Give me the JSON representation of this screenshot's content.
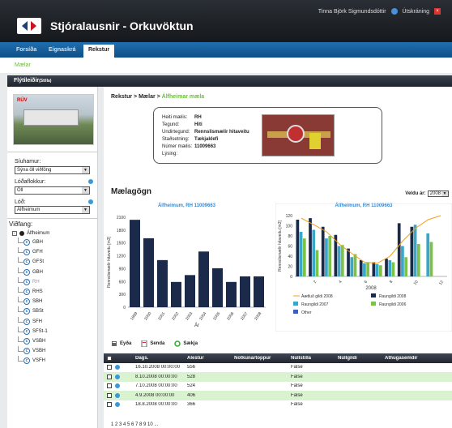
{
  "header": {
    "app_title": "Stjóralausnir - Orkuvöktun",
    "user_name": "Tinna Björk Sigmundsdóttir",
    "logout_label": "Útskráning"
  },
  "nav": {
    "tabs": [
      {
        "label": "Forsíða"
      },
      {
        "label": "Eignaskrá"
      },
      {
        "label": "Rekstur"
      }
    ],
    "sub_label": "Mælar"
  },
  "band": {
    "title": "Flýtileiðir",
    "subtitle": "(Stilla)"
  },
  "filters": {
    "photo_label": "RÚV",
    "siuhamur_label": "Síuhamur:",
    "siuhamur_value": "Sýna öll viðföng",
    "lodaflokkur_label": "Lóðaflokkur:",
    "lodaflokkur_value": "Öll",
    "lod_label": "Lóð:",
    "lod_value": "Álfheimum",
    "vidfang_label": "Viðfang:"
  },
  "tree": {
    "root": "Álfheimum",
    "nodes": [
      "GBH",
      "GFH",
      "GFSt",
      "GBH",
      "RH",
      "RHS",
      "SBH",
      "SBSt",
      "SFH",
      "SFSt-1",
      "VSBH",
      "VSBH",
      "VSFH"
    ]
  },
  "breadcrumb": {
    "part1": "Rekstur",
    "part2": "Mælar",
    "part3": "Álfheimar mæla"
  },
  "meter_info": {
    "rows": [
      {
        "k": "Heiti mælis:",
        "v": "RH"
      },
      {
        "k": "Tegund:",
        "v": "Hiti"
      },
      {
        "k": "Undirtegund:",
        "v": "Rennslismælir hitaveitu"
      },
      {
        "k": "Staðsetning:",
        "v": "Tækjaklefi"
      },
      {
        "k": "Númer mælis:",
        "v": "11009663"
      },
      {
        "k": "Lýsing:",
        "v": ""
      }
    ]
  },
  "readings": {
    "title": "Mælagögn",
    "year_label": "Veldu ár:",
    "year_value": "2008"
  },
  "chart_data": [
    {
      "type": "bar",
      "title": "Álfheimum, RH 11009663",
      "xlabel": "Ár",
      "ylabel": "Rennslismælir hitaveitu [m3]",
      "categories": [
        "1999",
        "2000",
        "2001",
        "2002",
        "2003",
        "2004",
        "2005",
        "2006",
        "2007",
        "2008"
      ],
      "values": [
        2040,
        1610,
        1100,
        590,
        750,
        1300,
        910,
        590,
        720,
        720
      ],
      "ylim": [
        0,
        2100
      ],
      "yticks": [
        0,
        300,
        600,
        900,
        1200,
        1500,
        1800,
        2100
      ],
      "colors": {
        "bar": "#1b2a4a"
      }
    },
    {
      "type": "bar",
      "title": "Álfheimum, RH 11009663",
      "xlabel": "2008",
      "ylabel": "Rennslismælir hitaveitu [m3]",
      "categories": [
        "1",
        "2",
        "3",
        "4",
        "5",
        "6",
        "7",
        "8",
        "9",
        "10",
        "11",
        "12"
      ],
      "ylim": [
        0,
        120
      ],
      "yticks": [
        0,
        20,
        40,
        60,
        80,
        100,
        120
      ],
      "xticks": [
        "2",
        "4",
        "6",
        "8",
        "10",
        "12"
      ],
      "series": [
        {
          "name": "Raungildi 2008",
          "color": "#1b2a4a",
          "values": [
            112,
            115,
            98,
            82,
            55,
            32,
            28,
            35,
            105,
            98,
            0,
            0
          ]
        },
        {
          "name": "Raungildi 2007",
          "color": "#3aa6c8",
          "values": [
            88,
            92,
            75,
            60,
            38,
            26,
            24,
            32,
            60,
            102,
            85,
            0
          ]
        },
        {
          "name": "Raungildi 2006",
          "color": "#7cc24a",
          "values": [
            75,
            52,
            80,
            62,
            44,
            28,
            22,
            28,
            38,
            64,
            68,
            0
          ]
        },
        {
          "name": "Other",
          "color": "#3a5fbf",
          "values": [
            0,
            0,
            0,
            0,
            0,
            0,
            0,
            0,
            0,
            0,
            0,
            0
          ]
        },
        {
          "name": "Áætluð gildi 2008",
          "color": "#f0a020",
          "type": "line",
          "values": [
            115,
            102,
            88,
            64,
            45,
            28,
            26,
            40,
            70,
            95,
            112,
            120
          ]
        }
      ],
      "legend_position": "bottom"
    }
  ],
  "toolbar": {
    "delete_label": "Eyða",
    "send_label": "Senda",
    "fetch_label": "Sækja"
  },
  "table": {
    "columns": [
      "Dags.",
      "Álestur",
      "Notkunartoppur",
      "Núllstilla",
      "Núllgildi",
      "Athugasemdir"
    ],
    "rows": [
      {
        "date": "16.10.2008 00:00:00",
        "reading": "556",
        "peak": "",
        "reset": "False",
        "zero": "",
        "note": ""
      },
      {
        "date": "8.10.2008 00:00:00",
        "reading": "528",
        "peak": "",
        "reset": "False",
        "zero": "",
        "note": ""
      },
      {
        "date": "7.10.2008 00:00:00",
        "reading": "524",
        "peak": "",
        "reset": "False",
        "zero": "",
        "note": ""
      },
      {
        "date": "4.9.2008 00:00:00",
        "reading": "406",
        "peak": "",
        "reset": "False",
        "zero": "",
        "note": ""
      },
      {
        "date": "18.8.2008 00:00:00",
        "reading": "366",
        "peak": "",
        "reset": "False",
        "zero": "",
        "note": ""
      }
    ]
  },
  "pager": {
    "text": "1 2 3 4 5 6 7 8 9 10 ..."
  }
}
